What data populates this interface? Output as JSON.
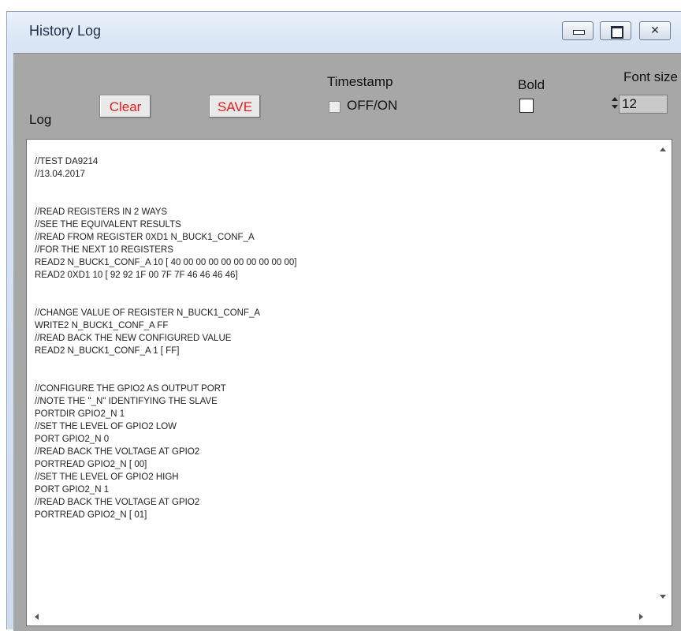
{
  "window": {
    "title": "History Log",
    "minimize_icon": "minimize-icon",
    "maximize_icon": "maximize-icon",
    "close_icon": "close-icon",
    "close_glyph": "✕"
  },
  "toolbar": {
    "log_label": "Log",
    "clear_label": "Clear",
    "save_label": "SAVE",
    "timestamp_title": "Timestamp",
    "timestamp_toggle_label": "OFF/ON",
    "timestamp_checked": false,
    "bold_label": "Bold",
    "bold_checked": false,
    "font_size_label": "Font size",
    "font_size_value": "12"
  },
  "colors": {
    "button_text": "#e01e1e",
    "panel_background": "#a7a7a7"
  },
  "log": {
    "lines": [
      "//TEST DA9214",
      "//13.04.2017",
      "",
      "",
      "//READ REGISTERS IN 2 WAYS",
      "//SEE THE EQUIVALENT RESULTS",
      "//READ FROM REGISTER 0XD1 N_BUCK1_CONF_A",
      "//FOR THE NEXT 10 REGISTERS",
      "READ2 N_BUCK1_CONF_A 10 [ 40 00 00 00 00 00 00 00 00 00]",
      "READ2 0XD1 10 [ 92 92 1F 00 7F 7F 46 46 46 46]",
      "",
      "",
      "//CHANGE VALUE OF REGISTER N_BUCK1_CONF_A",
      "WRITE2 N_BUCK1_CONF_A FF",
      "//READ BACK THE NEW CONFIGURED VALUE",
      "READ2 N_BUCK1_CONF_A 1 [ FF]",
      "",
      "",
      "//CONFIGURE THE GPIO2 AS OUTPUT PORT",
      "//NOTE THE \"_N\" IDENTIFYING THE SLAVE",
      "PORTDIR GPIO2_N 1",
      "//SET THE LEVEL OF GPIO2 LOW",
      "PORT GPIO2_N 0",
      "//READ BACK THE VOLTAGE AT GPIO2",
      "PORTREAD GPIO2_N [ 00]",
      "//SET THE LEVEL OF GPIO2 HIGH",
      "PORT GPIO2_N 1",
      "//READ BACK THE VOLTAGE AT GPIO2",
      "PORTREAD GPIO2_N [ 01]"
    ]
  }
}
